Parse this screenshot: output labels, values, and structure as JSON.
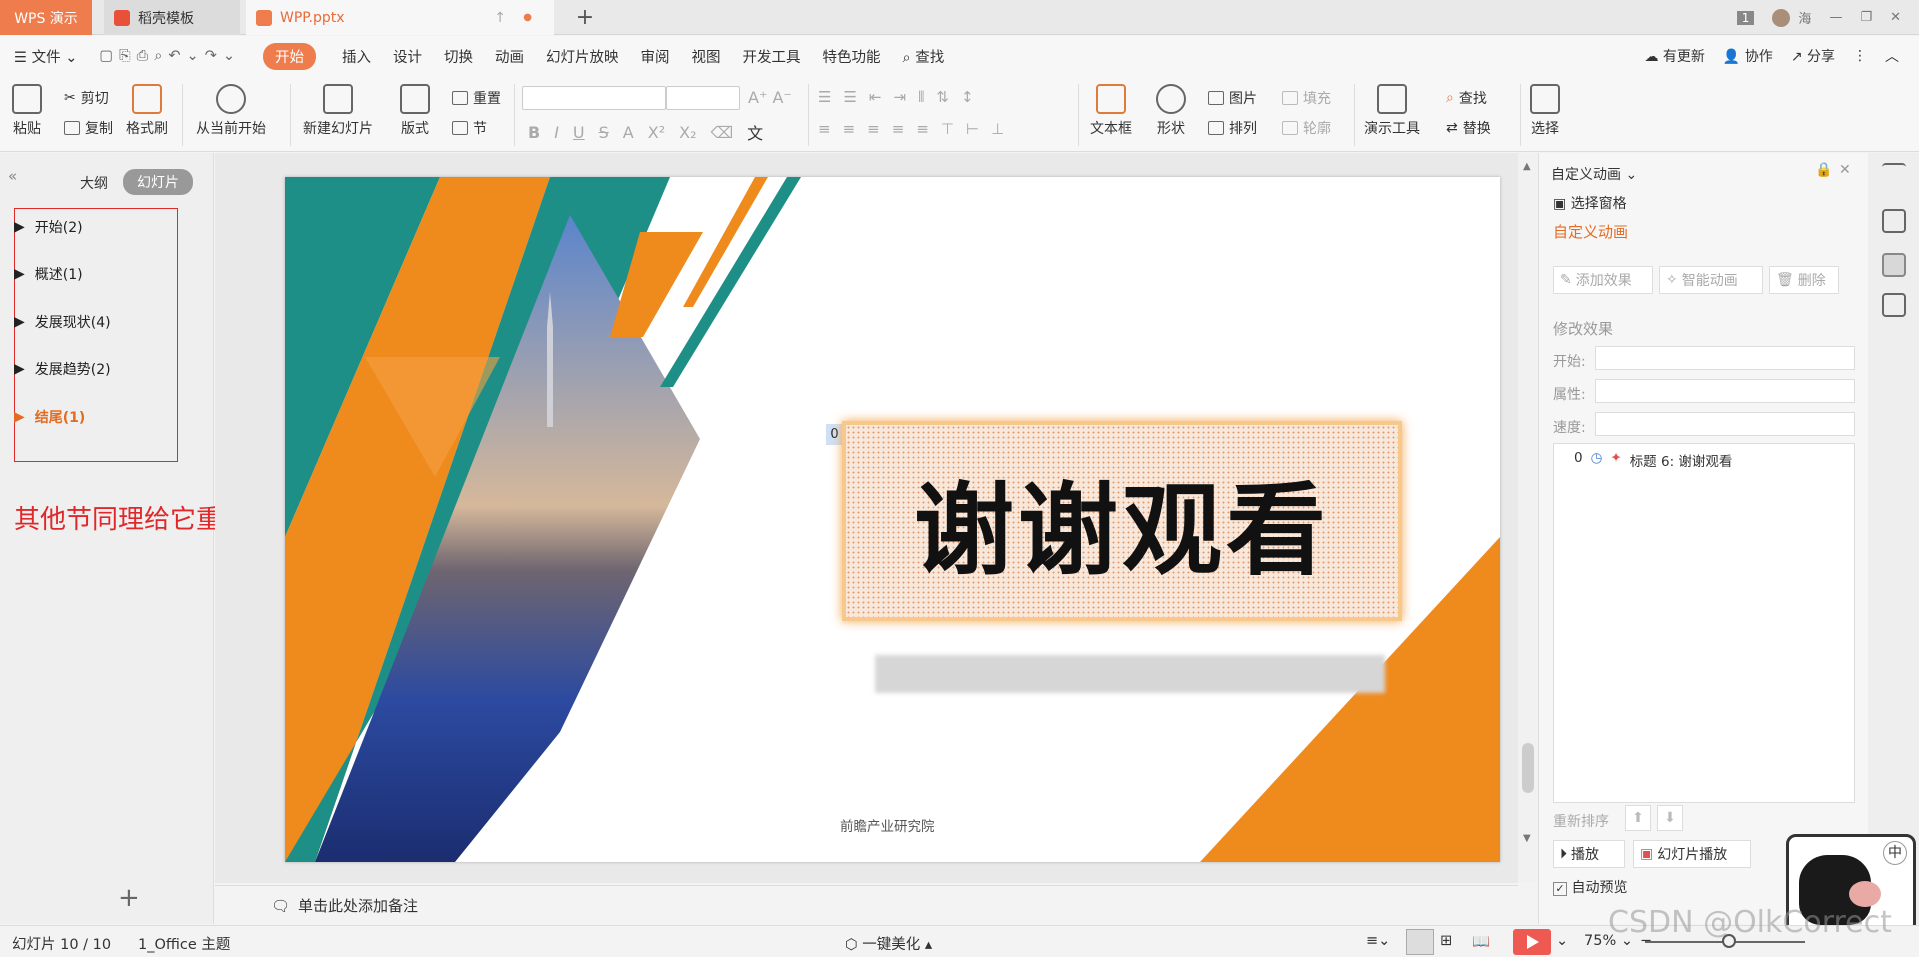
{
  "tabs": {
    "app": "WPS 演示",
    "template": "稻壳模板",
    "file": "WPP.pptx",
    "new_tab": "+"
  },
  "titlebar": {
    "page_badge": "1",
    "user": "海"
  },
  "menu": {
    "file": "文件",
    "items": [
      "开始",
      "插入",
      "设计",
      "切换",
      "动画",
      "幻灯片放映",
      "审阅",
      "视图",
      "开发工具",
      "特色功能"
    ],
    "search": "查找",
    "right": [
      "有更新",
      "协作",
      "分享"
    ]
  },
  "ribbon": {
    "paste": "粘贴",
    "cut": "剪切",
    "copy": "复制",
    "format_painter": "格式刷",
    "from_current": "从当前开始",
    "new_slide": "新建幻灯片",
    "layout": "版式",
    "reset": "重置",
    "section": "节",
    "font_buttons": [
      "B",
      "I",
      "U",
      "S",
      "A",
      "X²",
      "X₂",
      "文"
    ],
    "textbox": "文本框",
    "shape": "形状",
    "picture": "图片",
    "fill": "填充",
    "arrange": "排列",
    "outline": "轮廓",
    "present_tools": "演示工具",
    "find": "查找",
    "replace": "替换",
    "select": "选择"
  },
  "left_panel": {
    "tab_outline": "大纲",
    "tab_slides": "幻灯片",
    "sections": [
      {
        "label": "开始(2)"
      },
      {
        "label": "概述(1)"
      },
      {
        "label": "发展现状(4)"
      },
      {
        "label": "发展趋势(2)"
      },
      {
        "label": "结尾(1)"
      }
    ],
    "active_section": 4,
    "annotation": "其他节同理给它重命名"
  },
  "slide": {
    "title": "谢谢观看",
    "anim_index": "0",
    "footer": "前瞻产业研究院",
    "colors": {
      "teal": "#1e8f86",
      "orange": "#ef8a1c"
    }
  },
  "notes": {
    "placeholder": "单击此处添加备注"
  },
  "right_panel": {
    "header": "自定义动画",
    "select_pane": "选择窗格",
    "section_title": "自定义动画",
    "add_effect": "添加效果",
    "smart_anim": "智能动画",
    "delete": "删除",
    "modify": "修改效果",
    "start_label": "开始:",
    "property_label": "属性:",
    "speed_label": "速度:",
    "anim_item": {
      "index": "0",
      "label": "标题 6: 谢谢观看"
    },
    "reorder": "重新排序",
    "play": "播放",
    "slideshow": "幻灯片播放",
    "auto_preview": "自动预览",
    "auto_preview_checked": true
  },
  "status": {
    "slide_pos": "幻灯片 10 / 10",
    "theme": "1_Office 主题",
    "beautify": "一键美化",
    "zoom": "75%",
    "watermark": "CSDN @OlkCorrect"
  },
  "ime": {
    "lang": "中"
  }
}
